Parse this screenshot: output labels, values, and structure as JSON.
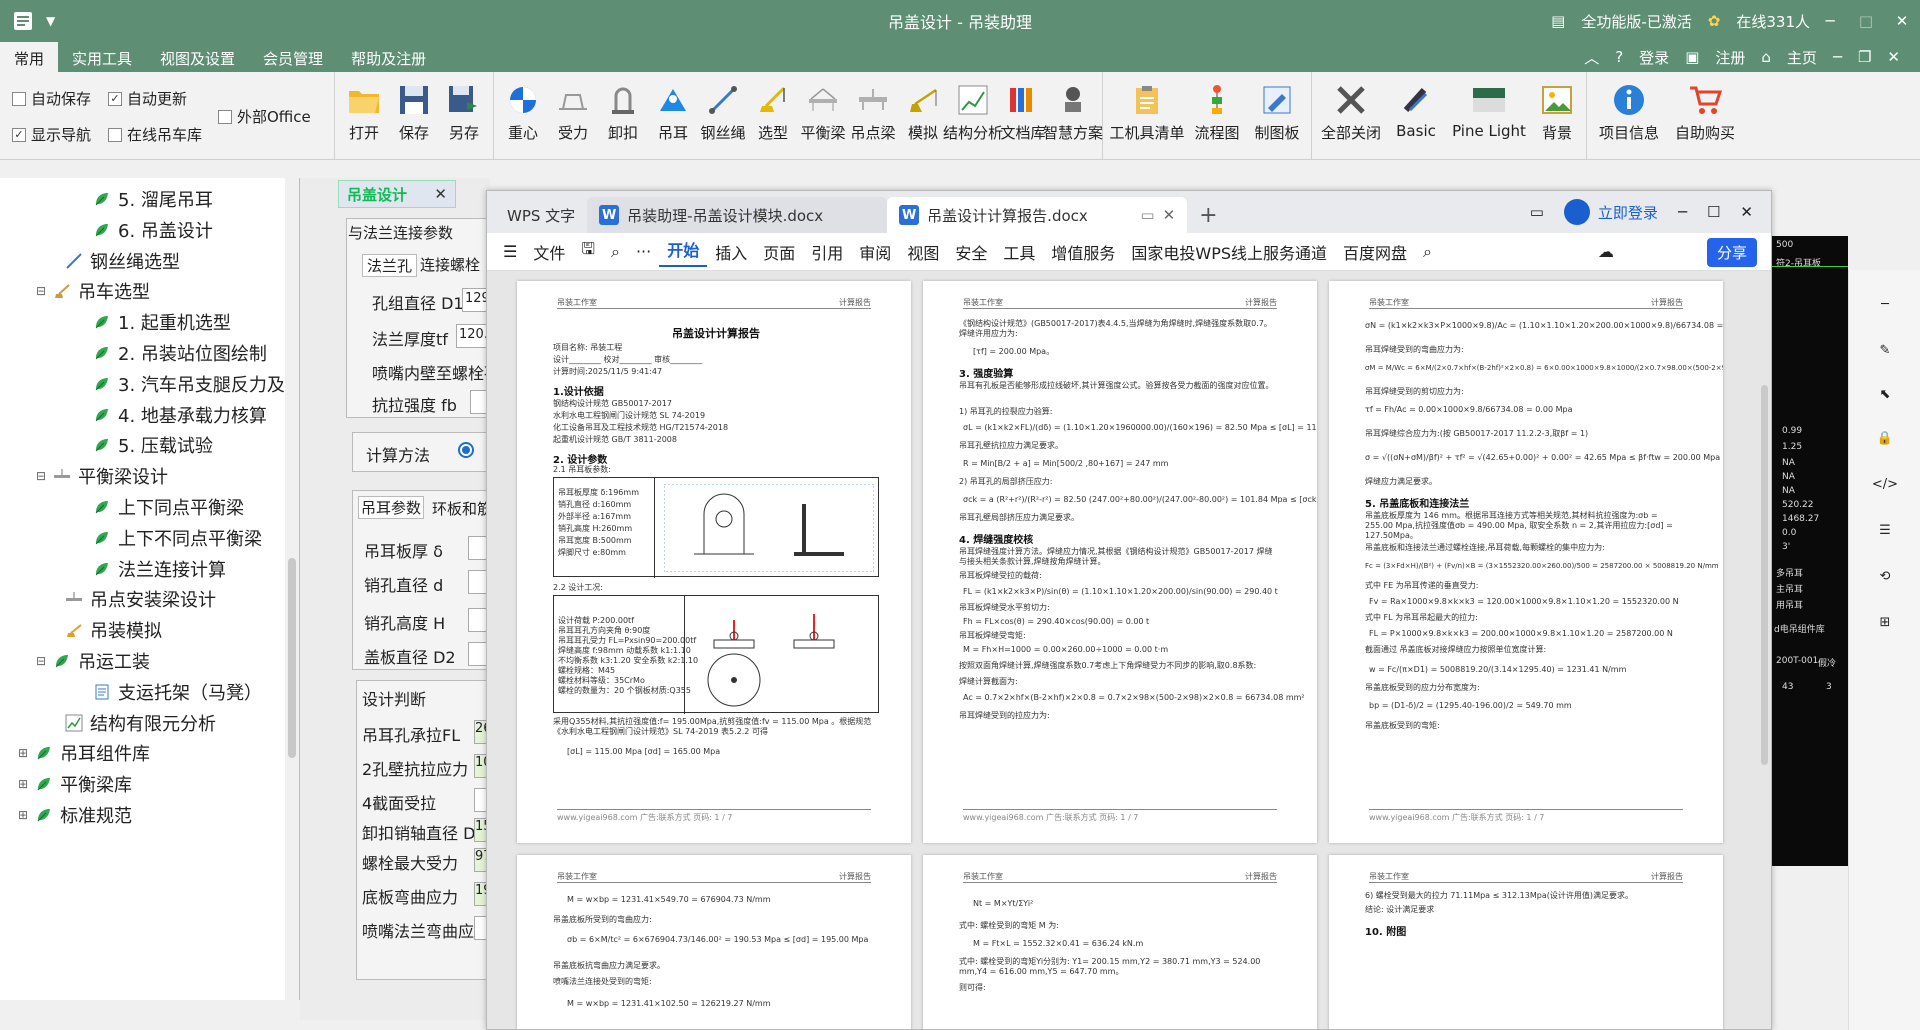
{
  "window": {
    "title": "吊盖设计 - 吊装助理",
    "version": "全功能版-已激活",
    "online": "在线331人",
    "controls": [
      "─",
      "□",
      "✕"
    ]
  },
  "ribbon_tabs": [
    "常用",
    "实用工具",
    "视图及设置",
    "会员管理",
    "帮助及注册"
  ],
  "ribbon_right": {
    "login": "登录",
    "register": "注册",
    "home": "主页"
  },
  "checkboxes": [
    {
      "label": "自动保存",
      "checked": false
    },
    {
      "label": "自动更新",
      "checked": true
    },
    {
      "label": "外部Office",
      "checked": false
    },
    {
      "label": "显示导航",
      "checked": true
    },
    {
      "label": "在线吊车库",
      "checked": false
    }
  ],
  "toolbar": {
    "file": [
      "打开",
      "保存",
      "另存"
    ],
    "calc": [
      "重心",
      "受力",
      "卸扣",
      "吊耳",
      "钢丝绳",
      "选型",
      "平衡梁",
      "吊点梁",
      "模拟",
      "结构分析",
      "文档库",
      "智慧方案"
    ],
    "tools": [
      "工机具清单",
      "流程图",
      "制图板"
    ],
    "view": [
      "全部关闭",
      "Basic",
      "Pine Light",
      "背景"
    ],
    "info": [
      "项目信息",
      "自助购买"
    ]
  },
  "tree": [
    {
      "label": "5. 溜尾吊耳",
      "level": 3,
      "icon": "leaf-icon"
    },
    {
      "label": "6. 吊盖设计",
      "level": 3,
      "icon": "leaf-icon"
    },
    {
      "label": "钢丝绳选型",
      "level": 2,
      "icon": "rope-icon"
    },
    {
      "label": "吊车选型",
      "level": 1,
      "icon": "crane-icon",
      "expander": "⊟"
    },
    {
      "label": "1. 起重机选型",
      "level": 3,
      "icon": "leaf-icon"
    },
    {
      "label": "2. 吊装站位图绘制",
      "level": 3,
      "icon": "leaf-icon"
    },
    {
      "label": "3. 汽车吊支腿反力及地",
      "level": 3,
      "icon": "leaf-icon"
    },
    {
      "label": "4. 地基承载力核算",
      "level": 3,
      "icon": "leaf-icon"
    },
    {
      "label": "5. 压载试验",
      "level": 3,
      "icon": "leaf-icon"
    },
    {
      "label": "平衡梁设计",
      "level": 1,
      "icon": "beam-icon",
      "expander": "⊟"
    },
    {
      "label": "上下同点平衡梁",
      "level": 3,
      "icon": "leaf-icon"
    },
    {
      "label": "上下不同点平衡梁",
      "level": 3,
      "icon": "leaf-icon"
    },
    {
      "label": "法兰连接计算",
      "level": 3,
      "icon": "leaf-icon"
    },
    {
      "label": "吊点安装梁设计",
      "level": 2,
      "icon": "beam-icon"
    },
    {
      "label": "吊装模拟",
      "level": 2,
      "icon": "sim-icon"
    },
    {
      "label": "吊运工装",
      "level": 1,
      "icon": "leaf-icon",
      "expander": "⊟"
    },
    {
      "label": "支运托架（马凳）",
      "level": 3,
      "icon": "doc-icon"
    },
    {
      "label": "结构有限元分析",
      "level": 2,
      "icon": "chart-icon"
    },
    {
      "label": "吊耳组件库",
      "level": 0,
      "icon": "leaf-icon",
      "expander": "⊞"
    },
    {
      "label": "平衡梁库",
      "level": 0,
      "icon": "leaf-icon",
      "expander": "⊞"
    },
    {
      "label": "标准规范",
      "level": 0,
      "icon": "leaf-icon",
      "expander": "⊞"
    }
  ],
  "middle": {
    "tab": "吊盖设计",
    "section_title": "与法兰连接参数",
    "subtabs": [
      "法兰孔",
      "连接螺栓"
    ],
    "flange_fields": [
      {
        "label": "孔组直径 D1",
        "value": "129"
      },
      {
        "label": "法兰厚度tf",
        "value": "120."
      },
      {
        "label": "喷嘴内壁至螺栓孔",
        "value": ""
      },
      {
        "label": "抗拉强度 fb",
        "value": ""
      }
    ],
    "calc_method": "计算方法",
    "lug_tabs": [
      "吊耳参数",
      "环板和筋"
    ],
    "lug_fields": [
      "吊耳板厚 δ",
      "销孔直径 d",
      "销孔高度 H",
      "盖板直径 D2"
    ],
    "judge_title": "设计判断",
    "judge_rows": [
      {
        "label": "吊耳孔承拉FL",
        "value": "26"
      },
      {
        "label": "2孔壁抗拉应力",
        "value": "10"
      },
      {
        "label": "4截面受拉",
        "value": ""
      },
      {
        "label": "卸扣销轴直径 D",
        "value": "15"
      },
      {
        "label": "螺栓最大受力",
        "value": "97"
      },
      {
        "label": "底板弯曲应力",
        "value": "19"
      },
      {
        "label": "喷嘴法兰弯曲应力",
        "value": ""
      }
    ]
  },
  "wps": {
    "tabs": [
      "WPS 文字",
      "吊装助理-吊盖设计模块.docx",
      "吊盖设计计算报告.docx"
    ],
    "login": "立即登录",
    "menu": [
      "文件",
      "开始",
      "插入",
      "页面",
      "引用",
      "审阅",
      "视图",
      "安全",
      "工具",
      "增值服务",
      "国家电投WPS线上服务通道",
      "百度网盘"
    ],
    "share": "分享",
    "page_header_left": "吊装工作室",
    "page_header_right": "计算报告",
    "footer": "www.yigeai968.com 广告:联系方式 页码: 1 / 7",
    "page1": {
      "title": "吊盖设计计算报告",
      "project": "项目名称:  吊装工程",
      "sign": "设计________ 校对________ 审核________",
      "date": "计算时间:2025/11/5 9:41:47",
      "h1": "1.设计依据",
      "refs": [
        "钢结构设计规范      GB50017-2017",
        "水利水电工程钢闸门设计规范  SL 74-2019",
        "化工设备吊耳及工程技术规范  HG/T21574-2018",
        "起重机设计规范        GB/T 3811-2008"
      ],
      "h2": "2. 设计参数",
      "sub": "2.1 吊耳板参数:",
      "params1": [
        "吊耳板厚度 δ:196mm",
        "销孔直径 d:160mm",
        "外部半径 a:167mm",
        "销孔高度 H:260mm",
        "吊耳宽度 B:500mm",
        "焊脚尺寸 e:80mm"
      ],
      "sub2": "2.2 设计工况:",
      "params2": [
        "设计荷载 P:200.00tf",
        "吊耳耳孔方向夹角 θ:90度",
        "吊耳耳孔受力 FL=Pxsin90=200.00tf",
        "焊缝高度 f:98mm 动载系数 k1:1.10",
        "不均衡系数 k3:1.20 安全系数 k2:1.10",
        "螺栓规格：M45",
        "螺栓材料等级：35CrMo",
        "螺栓的数量为：20 个钢板材质:Q355"
      ],
      "note": "采用Q355材料,其抗拉强度值:f= 195.00Mpa,抗剪强度值:fv = 115.00 Mpa 。根据规范《水利水电工程钢闸门设计规范》SL 74-2019 表5.2.2 可得",
      "eq": "[σL] = 115.00 Mpa [σd] = 165.00 Mpa"
    },
    "page2": {
      "top": "《钢结构设计规范》(GB50017-2017)表4.4.5,当焊缝为角焊缝时,焊缝强度系数取0.7。焊缝许用应力为:",
      "eq1": "[τf] = 200.00 Mpa。",
      "h3": "3. 强度验算",
      "txt": "吊耳有孔板是否能够形成拉线破坏,其计算强度公式。验算按各受力截面的强度对应位置。",
      "s1": "1) 吊耳孔的拉裂应力验算:",
      "eq2": "σL = (k1×k2×FL)/(dδ) = (1.10×1.20×1960000.00)/(160×196) = 82.50 Mpa ≤ [σL] = 115.00 Mpa",
      "r1": "吊耳孔壁抗拉应力满足要求。",
      "eq3": "R = Min[B/2 + a] = Min[500/2 ,80+167] = 247 mm",
      "s2": "2) 吊耳孔的局部挤压应力:",
      "eq4": "σck = a (R²+r²)/(R²-r²) = 82.50 (247.00²+80.00²)/(247.00²-80.00²) = 101.84 Mpa ≤ [σck] = 165.00 Mpa",
      "r2": "吊耳孔壁局部挤压应力满足要求。",
      "h4": "4. 焊缝强度校核",
      "txt2": "吊耳焊缝强度计算方法。焊缝应力情况,其根据《钢结构设计规范》GB50017-2017 焊缝与接头相关条款计算,焊缝按角焊缝计算。",
      "s3": "吊耳板焊缝受拉的载荷:",
      "eq5": "FL = (k1×k2×k3×P)/sin(θ) = (1.10×1.10×1.20×200.00)/sin(90.00) = 290.40 t",
      "s4": "吊耳板焊缝受水平剪切力:",
      "eq6": "Fh = FL×cos(θ) = 290.40×cos(90.00) = 0.00 t",
      "s5": "吊耳板焊缝受弯矩:",
      "eq7": "M = Fh×H=1000 = 0.00×260.00÷1000 = 0.00 t·m",
      "txt3": "按照双面角焊缝计算,焊缝强度系数0.7考虑上下角焊缝受力不同步的影响,取0.8系数:",
      "s6": "焊缝计算截面为:",
      "eq8": "Ac = 0.7×2×hf×(B-2×hf)×2×0.8 = 0.7×2×98×(500-2×98)×2×0.8 = 66734.08 mm²",
      "s7": "吊耳焊缝受到的拉应力为:"
    },
    "page3": {
      "eq1": "σN = (k1×k2×k3×P×1000×9.8)/Ac = (1.10×1.10×1.20×200.00×1000×9.8)/66734.08 = 42.65 Mpa",
      "s1": "吊耳焊缝受到的弯曲应力为:",
      "eq2": "σM = M/Wc = 6×M/(2×0.7×hf×(B-2hf)²×2×0.8) = 6×0.00×1000×9.8×1000/(2×0.7×98.00×(500-2×98)²×2×0.8) = 0.00 Mpa",
      "s2": "吊耳焊缝受到的剪切应力为:",
      "eq3": "τf = Fh/Ac = 0.00×1000×9.8/66734.08 = 0.00 Mpa",
      "s3": "吊耳焊缝综合应力为:(按 GB50017-2017 11.2.2-3,取βf = 1)",
      "eq4": "σ = √((σN+σM)/βf)² + τf² = √(42.65+0.00)² + 0.00² = 42.65 Mpa ≤ βf·ftw = 200.00 Mpa",
      "r1": "焊缝应力满足要求。",
      "h5": "5. 吊盖底板和连接法兰",
      "txt": "吊盖底板厚度为 146 mm。根据吊耳连接方式等相关规范,其材料抗拉强度为:σb = 255.00 Mpa,抗拉强度值σb = 490.00 Mpa, 取安全系数 n = 2,其许用拉应力:[σd] = 127.50Mpa。",
      "s4": "吊盖底板和连接法兰通过螺栓连接,吊耳荷载,每颗螺栓的集中应力为:",
      "eq5": "Fc = (3×Fd×H)/(B²) + (Fv/n)×B = (3×1552320.00×260.00)/500 = 2587200.00 × 5008819.20 N/mm",
      "s5": "式中 FE 为吊耳传递的垂直受力:",
      "eq6": "Fv = Ra×1000×9.8×k×k3 = 120.00×1000×9.8×1.10×1.20 = 1552320.00 N",
      "s6": "式中 FL 为吊耳吊起最大的拉力:",
      "eq7": "FL = P×1000×9.8×k×k3 = 200.00×1000×9.8×1.10×1.20 = 2587200.00 N",
      "s7": "截面通过 吊盖底板对接焊缝应力按照单位宽度计算:",
      "eq8": "w = Fc/(π×D1) = 5008819.20/(3.14×1295.40) = 1231.41 N/mm",
      "s8": "吊盖底板受到的应力分布宽度为:",
      "eq9": "bp = (D1-δ)/2 = (1295.40-196.00)/2 = 549.70 mm",
      "s9": "吊盖底板受到的弯矩:"
    },
    "page4": {
      "eq1": "M = w×bp = 1231.41×549.70 = 676904.73 N/mm",
      "s1": "吊盖底板所受到的弯曲应力:",
      "eq2": "σb = 6×M/tc² = 6×676904.73/146.00² = 190.53 Mpa ≤ [σd] = 195.00 Mpa",
      "r1": "吊盖底板抗弯曲应力满足要求。",
      "s2": "喷嘴法兰连接处受到的弯矩:",
      "eq3": "M = w×bp = 1231.41×102.50 = 126219.27 N/mm"
    },
    "page5": {
      "eq1": "Nt = M×Yt/ΣYi²",
      "s1": "式中: 螺栓受到的弯矩 M 为:",
      "eq2": "M = Ft×L = 1552.32×0.41 = 636.24 kN.m",
      "s2": "式中: 螺栓受到的弯矩Yi分别为: Y1= 200.15 mm,Y2 = 380.71 mm,Y3 = 524.00 mm,Y4 = 616.00 mm,Y5 = 647.70 mm。",
      "s3": "则可得:"
    },
    "page6": {
      "t1": "6) 螺栓受到最大的拉力 71.11Mpa ≤ 312.13Mpa(设计许用值)满足要求。",
      "t2": "结论: 设计满足要求",
      "h10": "10. 附图"
    }
  },
  "right_panel": {
    "cells": [
      "500",
      "符2-吊耳板",
      "0.99",
      "1.25",
      "NA",
      "NA",
      "NA",
      "520.22",
      "1468.27",
      "0.0",
      "3'",
      "多吊耳",
      "主吊耳",
      "用吊耳",
      "d电吊组件库",
      "200T-001",
      "假冷",
      "43",
      "3"
    ]
  }
}
